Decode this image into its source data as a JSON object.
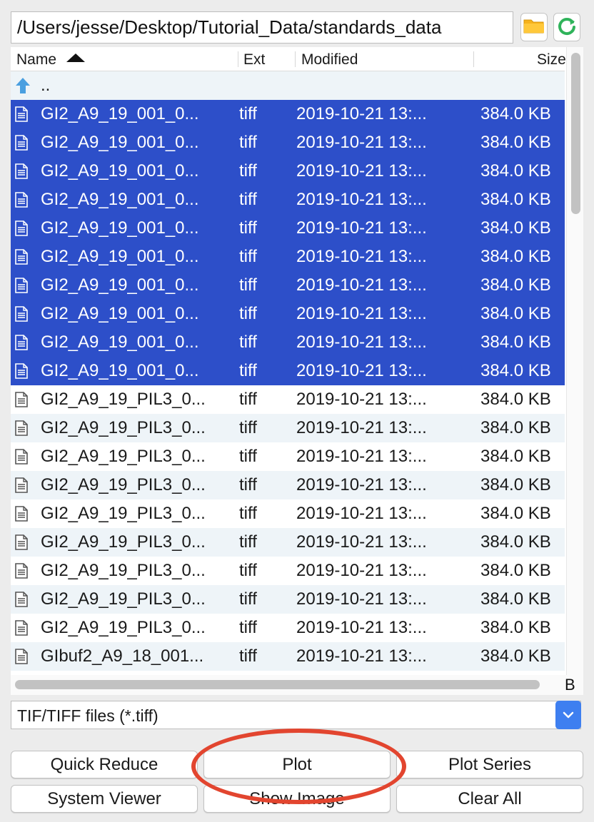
{
  "path_bar": {
    "value": "/Users/jesse/Desktop/Tutorial_Data/standards_data"
  },
  "toolbar": {
    "folder_icon": "folder-icon",
    "refresh_icon": "refresh-icon"
  },
  "columns": {
    "name": "Name",
    "ext": "Ext",
    "modified": "Modified",
    "size": "Size"
  },
  "parent_row": {
    "label": ".."
  },
  "rows": [
    {
      "name": "GI2_A9_19_001_0...",
      "ext": "tiff",
      "modified": "2019-10-21 13:...",
      "size": "384.0 KB",
      "selected": true
    },
    {
      "name": "GI2_A9_19_001_0...",
      "ext": "tiff",
      "modified": "2019-10-21 13:...",
      "size": "384.0 KB",
      "selected": true
    },
    {
      "name": "GI2_A9_19_001_0...",
      "ext": "tiff",
      "modified": "2019-10-21 13:...",
      "size": "384.0 KB",
      "selected": true
    },
    {
      "name": "GI2_A9_19_001_0...",
      "ext": "tiff",
      "modified": "2019-10-21 13:...",
      "size": "384.0 KB",
      "selected": true
    },
    {
      "name": "GI2_A9_19_001_0...",
      "ext": "tiff",
      "modified": "2019-10-21 13:...",
      "size": "384.0 KB",
      "selected": true
    },
    {
      "name": "GI2_A9_19_001_0...",
      "ext": "tiff",
      "modified": "2019-10-21 13:...",
      "size": "384.0 KB",
      "selected": true
    },
    {
      "name": "GI2_A9_19_001_0...",
      "ext": "tiff",
      "modified": "2019-10-21 13:...",
      "size": "384.0 KB",
      "selected": true
    },
    {
      "name": "GI2_A9_19_001_0...",
      "ext": "tiff",
      "modified": "2019-10-21 13:...",
      "size": "384.0 KB",
      "selected": true
    },
    {
      "name": "GI2_A9_19_001_0...",
      "ext": "tiff",
      "modified": "2019-10-21 13:...",
      "size": "384.0 KB",
      "selected": true
    },
    {
      "name": "GI2_A9_19_001_0...",
      "ext": "tiff",
      "modified": "2019-10-21 13:...",
      "size": "384.0 KB",
      "selected": true
    },
    {
      "name": "GI2_A9_19_PIL3_0...",
      "ext": "tiff",
      "modified": "2019-10-21 13:...",
      "size": "384.0 KB",
      "selected": false
    },
    {
      "name": "GI2_A9_19_PIL3_0...",
      "ext": "tiff",
      "modified": "2019-10-21 13:...",
      "size": "384.0 KB",
      "selected": false
    },
    {
      "name": "GI2_A9_19_PIL3_0...",
      "ext": "tiff",
      "modified": "2019-10-21 13:...",
      "size": "384.0 KB",
      "selected": false
    },
    {
      "name": "GI2_A9_19_PIL3_0...",
      "ext": "tiff",
      "modified": "2019-10-21 13:...",
      "size": "384.0 KB",
      "selected": false
    },
    {
      "name": "GI2_A9_19_PIL3_0...",
      "ext": "tiff",
      "modified": "2019-10-21 13:...",
      "size": "384.0 KB",
      "selected": false
    },
    {
      "name": "GI2_A9_19_PIL3_0...",
      "ext": "tiff",
      "modified": "2019-10-21 13:...",
      "size": "384.0 KB",
      "selected": false
    },
    {
      "name": "GI2_A9_19_PIL3_0...",
      "ext": "tiff",
      "modified": "2019-10-21 13:...",
      "size": "384.0 KB",
      "selected": false
    },
    {
      "name": "GI2_A9_19_PIL3_0...",
      "ext": "tiff",
      "modified": "2019-10-21 13:...",
      "size": "384.0 KB",
      "selected": false
    },
    {
      "name": "GI2_A9_19_PIL3_0...",
      "ext": "tiff",
      "modified": "2019-10-21 13:...",
      "size": "384.0 KB",
      "selected": false
    },
    {
      "name": "GIbuf2_A9_18_001...",
      "ext": "tiff",
      "modified": "2019-10-21 13:...",
      "size": "384.0 KB",
      "selected": false
    }
  ],
  "hscroll_corner_text": "B",
  "filter": {
    "value": "TIF/TIFF files (*.tiff)"
  },
  "buttons": {
    "quick_reduce": "Quick Reduce",
    "plot": "Plot",
    "plot_series": "Plot Series",
    "system_viewer": "System Viewer",
    "show_image": "Show Image",
    "clear_all": "Clear All"
  },
  "colors": {
    "selection": "#2d4fc9",
    "alt_row": "#eef4f8",
    "annotation": "#e2452f",
    "select_arrow": "#3e7ff0"
  }
}
